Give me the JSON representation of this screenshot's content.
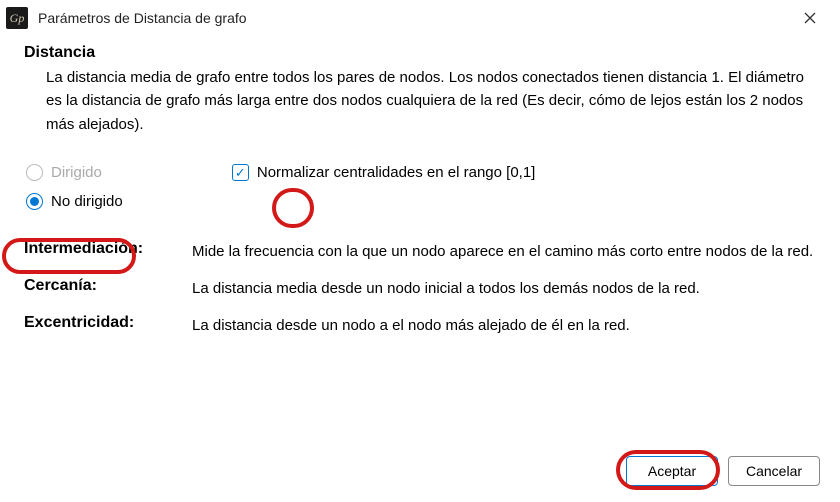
{
  "window": {
    "title": "Parámetros de Distancia de grafo",
    "app_icon_text": "Gp"
  },
  "section": {
    "heading": "Distancia",
    "description": "La distancia media de grafo entre todos los pares de nodos. Los nodos conectados tienen distancia 1. El diámetro es la distancia de grafo más larga entre dos nodos cualquiera de la red (Es decir, cómo de lejos están los 2 nodos más alejados)."
  },
  "options": {
    "directed_label": "Dirigido",
    "directed_selected": false,
    "directed_enabled": false,
    "undirected_label": "No dirigido",
    "undirected_selected": true,
    "normalize_label": "Normalizar centralidades en el rango [0,1]",
    "normalize_checked": true
  },
  "definitions": [
    {
      "term": "Intermediación:",
      "desc": "Mide la frecuencia con la que un nodo aparece en el camino más corto entre nodos de la red."
    },
    {
      "term": "Cercanía:",
      "desc": "La distancia media desde un nodo inicial a todos los demás nodos de la red."
    },
    {
      "term": "Excentricidad:",
      "desc": "La distancia desde un nodo a el nodo más alejado de él en la red."
    }
  ],
  "buttons": {
    "accept": "Aceptar",
    "cancel": "Cancelar"
  }
}
